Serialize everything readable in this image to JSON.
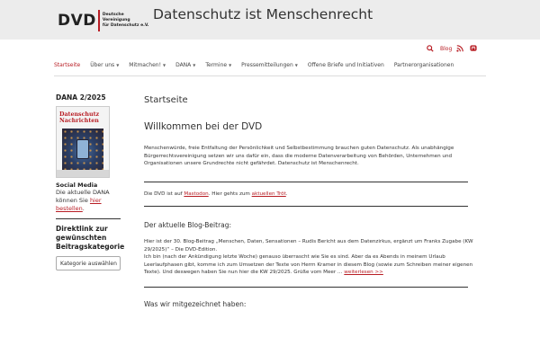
{
  "header": {
    "logo_text": "DVD",
    "logo_subtitle_line1": "Deutsche Vereinigung",
    "logo_subtitle_line2": "für Datenschutz e.V.",
    "site_title": "Datenschutz ist Menschenrecht",
    "background": "#ececec"
  },
  "utility": {
    "search_icon": "search-icon",
    "blog_label": "Blog",
    "rss_icon": "rss-icon",
    "mastodon_icon": "mastodon-icon"
  },
  "nav": {
    "items": [
      {
        "label": "Startseite",
        "active": true,
        "has_caret": false
      },
      {
        "label": "Über uns",
        "active": false,
        "has_caret": true
      },
      {
        "label": "Mitmachen!",
        "active": false,
        "has_caret": true
      },
      {
        "label": "DANA",
        "active": false,
        "has_caret": true
      },
      {
        "label": "Termine",
        "active": false,
        "has_caret": true
      },
      {
        "label": "Pressemitteilungen",
        "active": false,
        "has_caret": true
      },
      {
        "label": "Offene Briefe und Initiativen",
        "active": false,
        "has_caret": false
      },
      {
        "label": "Partnerorganisationen",
        "active": false,
        "has_caret": false
      }
    ]
  },
  "sidebar": {
    "dana_heading": "DANA 2/2025",
    "cover_title_line1": "Datenschutz",
    "cover_title_line2": "Nachrichten",
    "social_heading": "Social Media",
    "social_text_1": "Die aktuelle DANA",
    "social_text_2": "können Sie ",
    "social_link_1": "hier",
    "social_link_2": "bestellen",
    "social_text_3": ".",
    "direktlink_heading": "Direktlink zur gewünschten Beitragskategorie",
    "select_value": "Kategorie auswählen"
  },
  "main": {
    "page_heading": "Startseite",
    "welcome_heading": "Willkommen bei der DVD",
    "intro_text": "Menschenwürde, freie Entfaltung der Persönlichkeit und Selbstbestimmung brauchen guten Datenschutz. Als unabhängige Bürgerrechtsvereinigung setzen wir uns dafür ein, dass die moderne Datenverarbeitung von Behörden, Unternehmen und Organisationen unsere Grundrechte nicht gefährdet. Datenschutz ist Menschenrecht.",
    "mastodon_text_1": "Die DVD ist auf ",
    "mastodon_link": "Mastodon",
    "mastodon_text_2": ". Hier gehts zum ",
    "mastodon_link_2": "aktuellen Tröt",
    "mastodon_text_3": ".",
    "blog_heading": "Der aktuelle Blog-Beitrag:",
    "blog_line_1": "Hier ist der 30. Blog-Beitrag „Menschen, Daten, Sensationen – Rudis Bericht aus dem Datenzirkus, ergänzt um Franks Zugabe (KW 29/2025)“ – Die DVD-Edition.",
    "blog_line_2": "Ich bin (nach der Ankündigung letzte Woche) genauso überrascht wie Sie es sind. Aber da es Abends in meinem Urlaub Leerlaufphasen gibt, komme ich zum Umsetzen der Texte von Herrn Kramer in diesem Blog (sowie zum Schreiben meiner eigenen Texte). Und deswegen haben Sie nun hier die KW 29/2025. Grüße vom Meer … ",
    "blog_link": "weiterlesen >>",
    "signed_heading": "Was wir mitgezeichnet haben:"
  },
  "colors": {
    "accent": "#b81d24",
    "text": "#333333",
    "header_bg": "#ececec"
  }
}
